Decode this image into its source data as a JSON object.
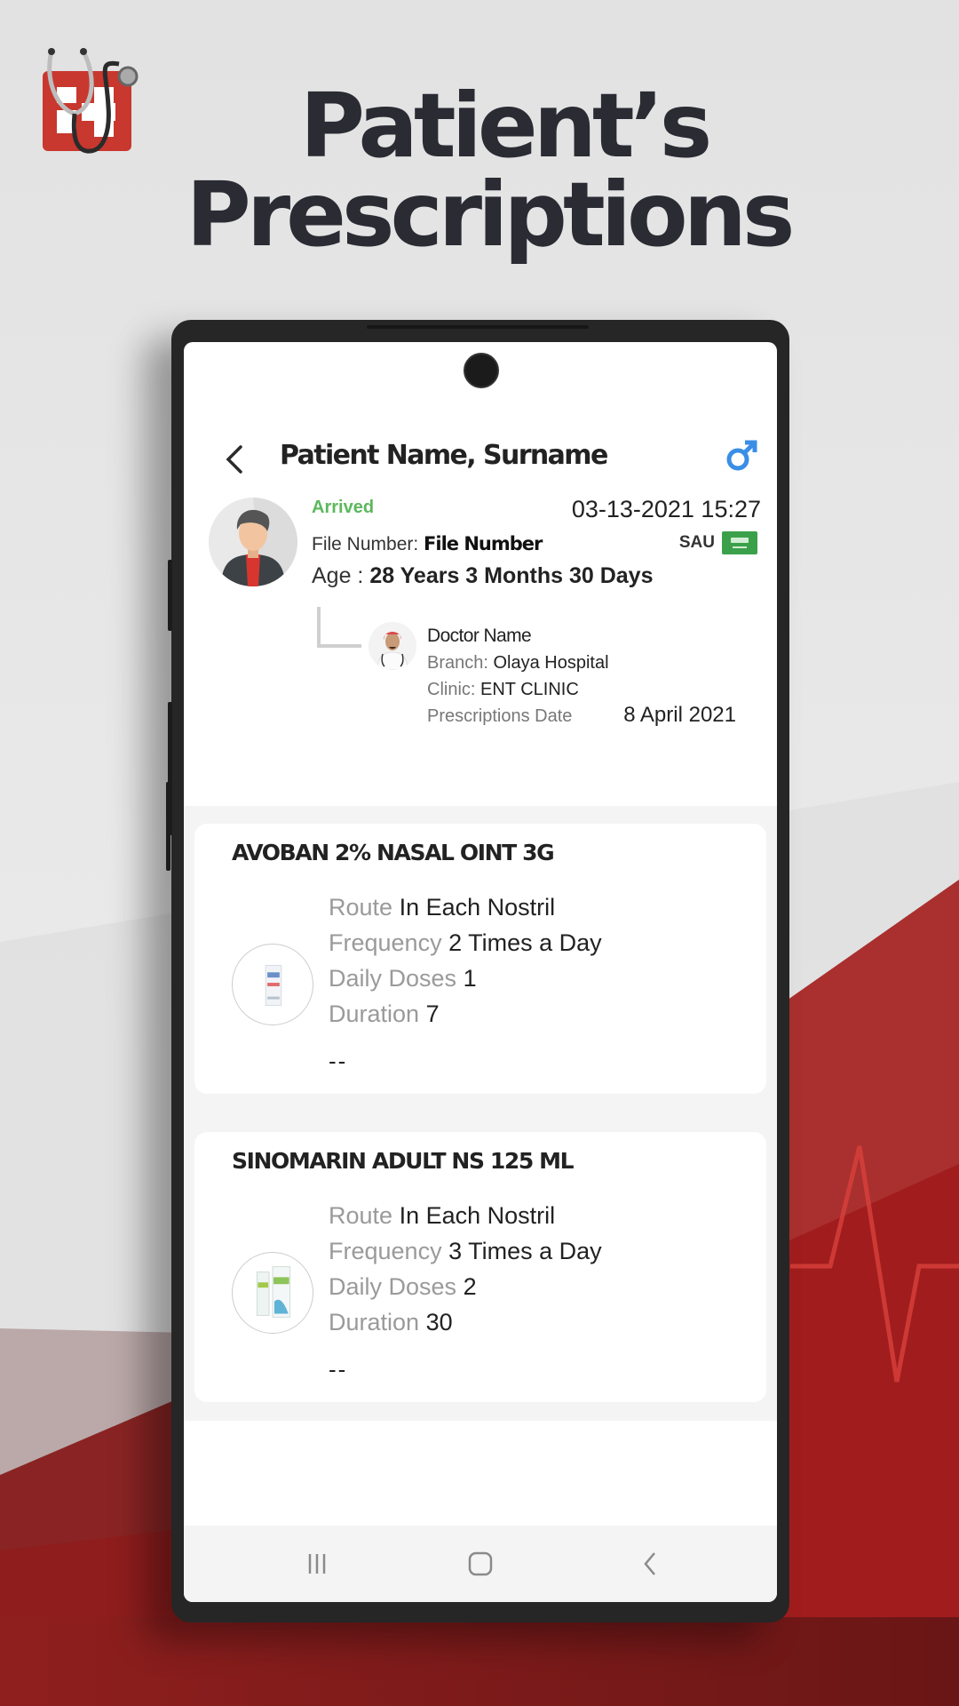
{
  "promo": {
    "headline_line1": "Patient’s",
    "headline_line2": "Prescriptions",
    "brand_color": "#c8382e",
    "logo_icon": "stethoscope-cross-logo"
  },
  "app": {
    "back_icon": "chevron-left-icon",
    "title": "Patient Name, Surname",
    "gender_icon": "male-symbol-icon",
    "gender_color": "#3a8ee6"
  },
  "patient": {
    "status": "Arrived",
    "status_color": "#5cb85c",
    "datetime": "03-13-2021 15:27",
    "file_number_label": "File Number:",
    "file_number_value": "File Number",
    "country_code": "SAU",
    "country_flag_icon": "saudi-flag-icon",
    "age_label": "Age :",
    "age_value": "28 Years  3 Months 30 Days"
  },
  "doctor": {
    "name": "Doctor Name",
    "branch_label": "Branch:",
    "branch_value": "Olaya Hospital",
    "clinic_label": "Clinic:",
    "clinic_value": "ENT CLINIC",
    "date_label": "Prescriptions Date",
    "date_value": "8 April 2021"
  },
  "prescriptions": [
    {
      "name": "AVOBAN 2% NASAL OINT 3G",
      "route_label": "Route",
      "route": "In Each Nostril",
      "frequency_label": "Frequency",
      "frequency": "2 Times a Day",
      "doses_label": "Daily Doses",
      "doses": "1",
      "duration_label": "Duration",
      "duration": "7",
      "note": "--"
    },
    {
      "name": "SINOMARIN ADULT NS 125 ML",
      "route_label": "Route",
      "route": "In Each Nostril",
      "frequency_label": "Frequency",
      "frequency": "3 Times a Day",
      "doses_label": "Daily Doses",
      "doses": "2",
      "duration_label": "Duration",
      "duration": "30",
      "note": "--"
    }
  ],
  "system_nav": {
    "recents_icon": "recents-icon",
    "home_icon": "home-icon",
    "back_icon": "system-back-icon"
  }
}
